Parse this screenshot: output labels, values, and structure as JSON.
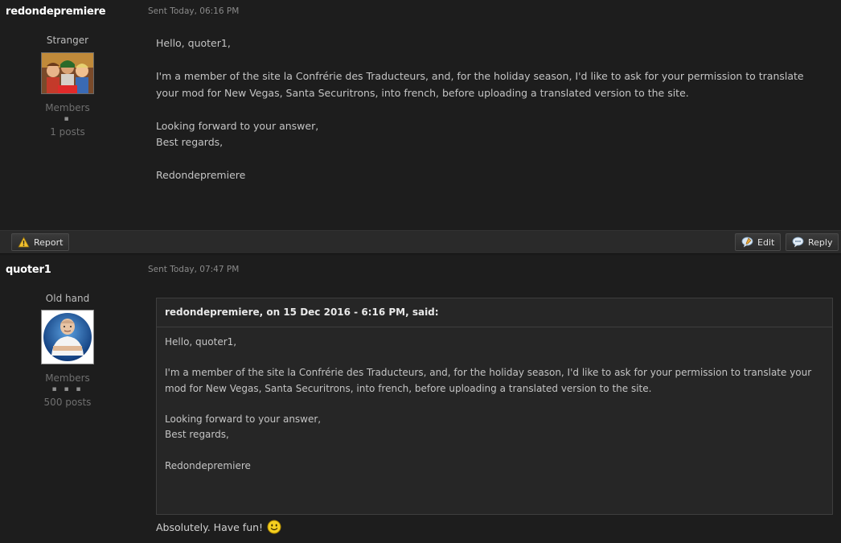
{
  "posts": [
    {
      "author": "redondepremiere",
      "date": "Sent Today, 06:16 PM",
      "rank": "Stranger",
      "group": "Members",
      "pips": "▪",
      "post_count": "1 posts",
      "body": [
        "Hello, quoter1,",
        "I'm a member of the site la Confrérie des Traducteurs, and, for the holiday season, I'd like to ask for your permission to translate your mod for New Vegas, Santa Securitrons, into french, before uploading a translated version to the site.",
        "Looking forward to your answer,",
        "Best regards,",
        "Redondepremiere"
      ]
    },
    {
      "author": "quoter1",
      "date": "Sent Today, 07:47 PM",
      "rank": "Old hand",
      "group": "Members",
      "pips": "▪ ▪ ▪",
      "post_count": "500 posts",
      "quote": {
        "header": "redondepremiere, on 15 Dec 2016 - 6:16 PM, said:",
        "body": [
          "Hello, quoter1,",
          "I'm a member of the site la Confrérie des Traducteurs, and, for the holiday season, I'd like to ask for your permission to translate your mod for New Vegas, Santa Securitrons, into french, before uploading a translated version to the site.",
          "Looking forward to your answer,",
          "Best regards,",
          "Redondepremiere"
        ]
      },
      "reply": "Absolutely. Have fun!"
    }
  ],
  "actions": {
    "report": "Report",
    "edit": "Edit",
    "reply": "Reply"
  },
  "icons": {
    "report": "warning-icon",
    "edit": "edit-bubble-icon",
    "reply": "reply-bubble-icon",
    "emoticon": "smiley-icon"
  },
  "colors": {
    "background": "#1c1c1c",
    "author": "#ffffff",
    "muted": "#6f6f6f"
  }
}
